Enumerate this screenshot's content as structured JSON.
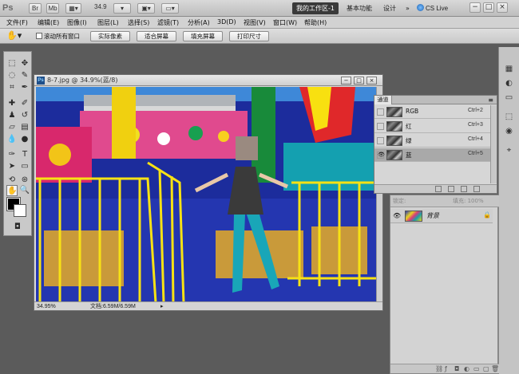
{
  "app": {
    "logo": "Ps",
    "zoom": "34.9",
    "workspace_active": "我的工作区-1",
    "workspaces": [
      "基本功能",
      "设计"
    ],
    "more": "»",
    "cs_live": "CS Live",
    "window_controls": [
      "−",
      "□",
      "×"
    ]
  },
  "menu": [
    "文件(F)",
    "编辑(E)",
    "图像(I)",
    "图层(L)",
    "选择(S)",
    "滤镜(T)",
    "分析(A)",
    "3D(D)",
    "视图(V)",
    "窗口(W)",
    "帮助(H)"
  ],
  "options": {
    "checkbox_label": "滚动所有窗口",
    "buttons": [
      "实际像素",
      "适合屏幕",
      "填充屏幕",
      "打印尺寸"
    ]
  },
  "document": {
    "title": "8-7.jpg @ 34.9%(蓝/8)",
    "zoom_readout": "34.95%",
    "doc_info": "文档:6.59M/6.59M",
    "buttons": [
      "−",
      "□",
      "×"
    ]
  },
  "channels": {
    "tab": "通道",
    "rows": [
      {
        "name": "RGB",
        "shortcut": "Ctrl+2",
        "visible": false
      },
      {
        "name": "红",
        "shortcut": "Ctrl+3",
        "visible": false
      },
      {
        "name": "绿",
        "shortcut": "Ctrl+4",
        "visible": false
      },
      {
        "name": "蓝",
        "shortcut": "Ctrl+5",
        "visible": true
      }
    ]
  },
  "layers": {
    "lock_label": "锁定:",
    "fill_label": "填充: 100%",
    "row": {
      "name": "背景"
    }
  },
  "colors": {
    "accent": "#3a3a3a",
    "channel_selected": "#a9a9a9"
  }
}
